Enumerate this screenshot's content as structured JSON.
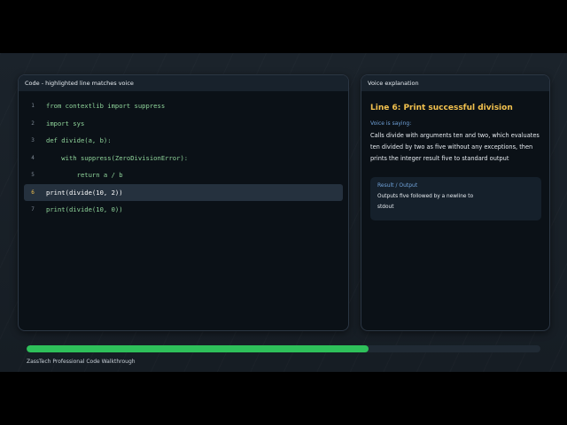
{
  "code_panel": {
    "header": "Code - highlighted line matches voice",
    "active_line": 6,
    "lines": [
      {
        "num": "1",
        "text": "from contextlib import suppress"
      },
      {
        "num": "2",
        "text": "import sys"
      },
      {
        "num": "3",
        "text": "def divide(a, b):"
      },
      {
        "num": "4",
        "text": "    with suppress(ZeroDivisionError):"
      },
      {
        "num": "5",
        "text": "        return a / b"
      },
      {
        "num": "6",
        "text": "print(divide(10, 2))"
      },
      {
        "num": "7",
        "text": "print(divide(10, 0))"
      }
    ]
  },
  "voice_panel": {
    "header": "Voice explanation",
    "title": "Line 6: Print successful division",
    "saying_label": "Voice is saying:",
    "explanation": "Calls divide with arguments ten and two, which evaluates ten divided by two as five without any exceptions, then prints the integer result five to standard output",
    "result_label": "Result / Output",
    "result_text": "Outputs five followed by a newline to stdout"
  },
  "progress": {
    "fraction": 0.665
  },
  "footer": {
    "text": "ZassTech Professional Code Walkthrough"
  },
  "colors": {
    "accent_yellow": "#f2c14e",
    "accent_blue": "#6fa1d8",
    "progress_green": "#2ec05a",
    "code_green": "#8fd49a"
  }
}
